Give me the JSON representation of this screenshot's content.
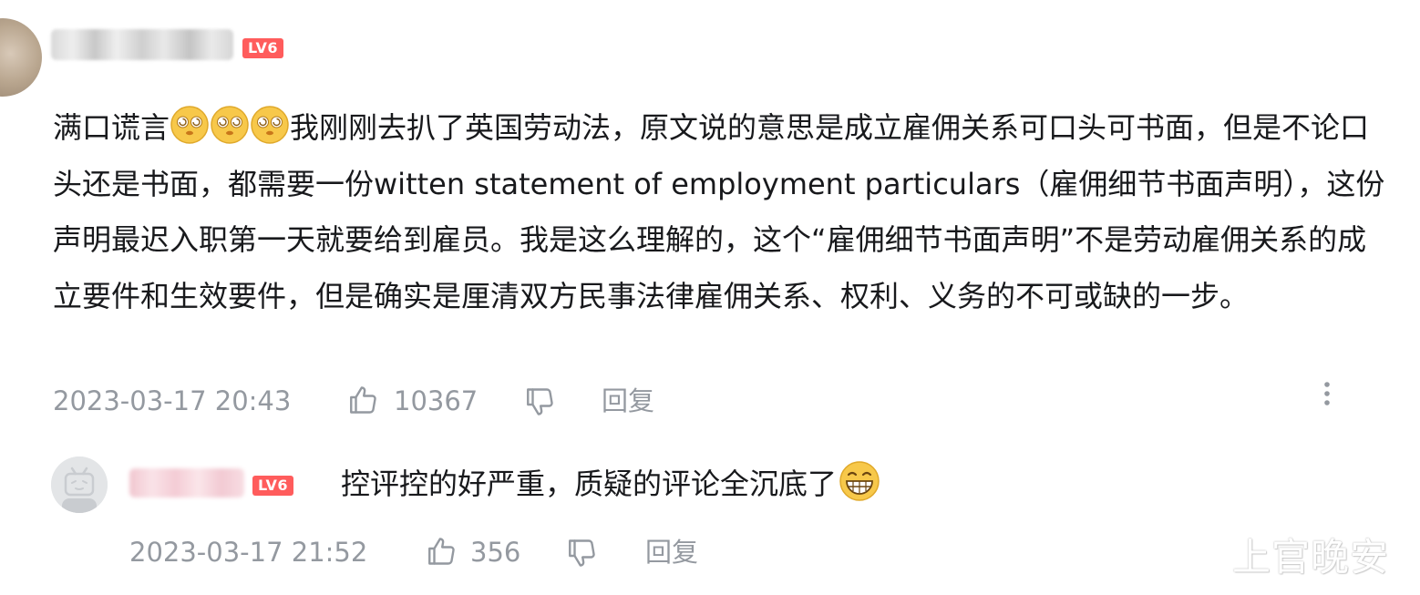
{
  "comment": {
    "username": "",
    "level": "LV6",
    "text_parts": [
      "满口谎言",
      "我刚刚去扒了英国劳动法，原文说的意思是成立雇佣关系可口头可书面，但是不论口头还是书面，都需要一份witten statement of employment particulars（雇佣细节书面声明），这份声明最迟入职第一天就要给到雇员。我是这么理解的，这个“雇佣细节书面声明”不是劳动雇佣关系的成立要件和生效要件，但是确实是厘清双方民事法律雇佣关系、权利、义务的不可或缺的一步。"
    ],
    "inline_emojis": [
      "dizzy-face-emoji",
      "dizzy-face-emoji",
      "dizzy-face-emoji"
    ],
    "timestamp": "2023-03-17 20:43",
    "like_count": "10367",
    "reply_label": "回复",
    "icons": {
      "like": "thumbs-up-icon",
      "dislike": "thumbs-down-icon",
      "more": "more-vertical-icon"
    }
  },
  "reply": {
    "username": "",
    "level": "LV6",
    "text": "控评控的好严重，质疑的评论全沉底了",
    "trailing_emoji": "grinning-face-emoji",
    "timestamp": "2023-03-17 21:52",
    "like_count": "356",
    "reply_label": "回复"
  },
  "watermark": "上官晚安",
  "colors": {
    "text": "#18191c",
    "meta": "#9499a0",
    "level_badge": "#ff5c5c",
    "emoji_yellow": "#f7c84a"
  }
}
